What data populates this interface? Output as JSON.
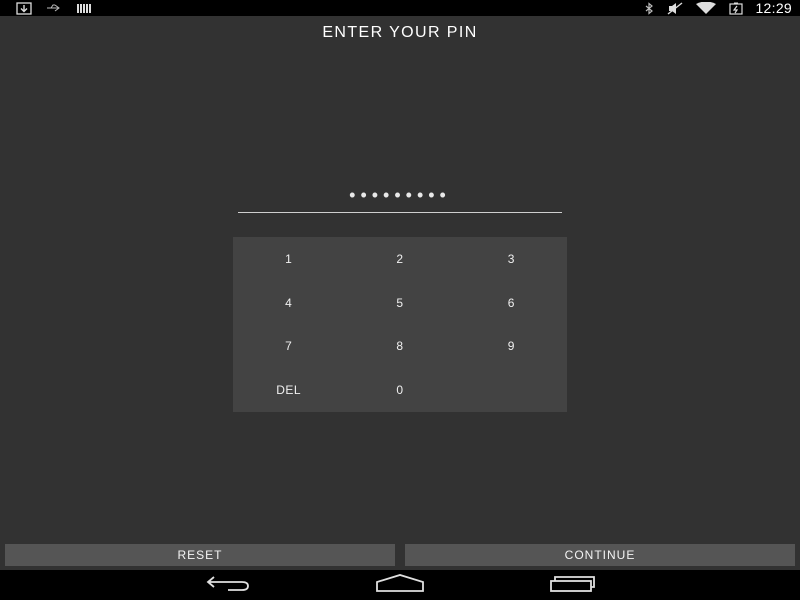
{
  "status_bar": {
    "left_icons": [
      "download-icon",
      "usb-icon",
      "keyboard-icon"
    ],
    "right_icons": [
      "bluetooth-icon",
      "mute-icon",
      "wifi-icon",
      "battery-icon"
    ],
    "time": "12:29"
  },
  "screen": {
    "title": "ENTER YOUR PIN",
    "pin_mask": "•••••••••"
  },
  "keypad": {
    "keys": [
      "1",
      "2",
      "3",
      "4",
      "5",
      "6",
      "7",
      "8",
      "9",
      "DEL",
      "0",
      ""
    ]
  },
  "actions": {
    "reset_label": "RESET",
    "continue_label": "CONTINUE"
  },
  "navigation": {
    "icons": [
      "back-icon",
      "home-icon",
      "recent-apps-icon"
    ]
  },
  "colors": {
    "background": "#323232",
    "keypad": "#434343",
    "button": "#555555",
    "bars": "#000000"
  }
}
